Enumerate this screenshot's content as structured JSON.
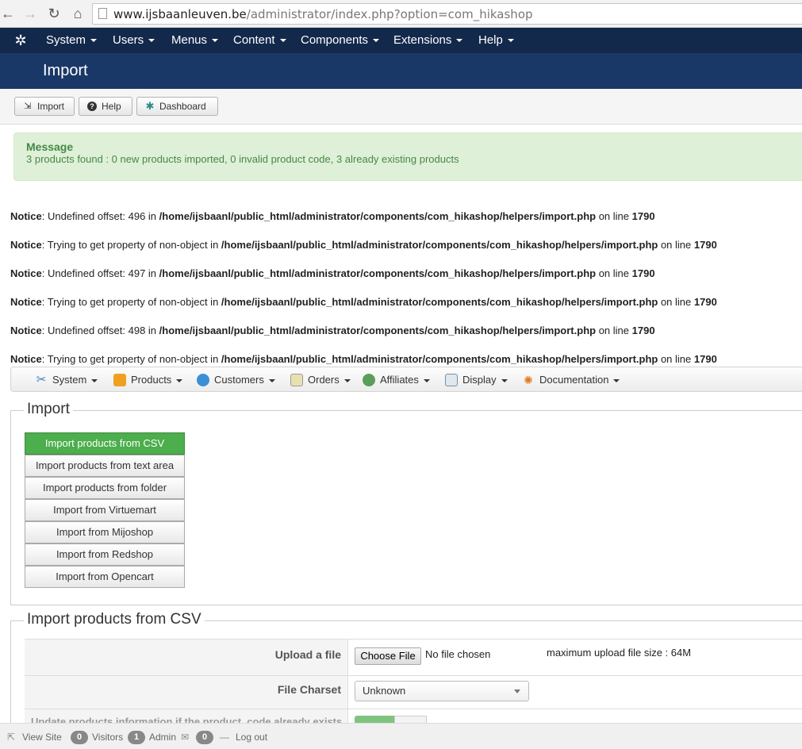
{
  "browser": {
    "url_host": "www.ijsbaanleuven.be",
    "url_path": "/administrator/index.php?option=com_hikashop"
  },
  "topnav": {
    "items": [
      "System",
      "Users",
      "Menus",
      "Content",
      "Components",
      "Extensions",
      "Help"
    ]
  },
  "header": {
    "title": "Import"
  },
  "toolbar": {
    "import_label": "Import",
    "help_label": "Help",
    "dashboard_label": "Dashboard"
  },
  "message": {
    "title": "Message",
    "text": "3 products found : 0 new products imported, 0 invalid product code, 3 already existing products"
  },
  "notices": [
    {
      "label": "Notice",
      "text": ": Undefined offset: 496 in ",
      "path": "/home/ijsbaanl/public_html/administrator/components/com_hikashop/helpers/import.php",
      "online": " on line ",
      "line": "1790"
    },
    {
      "label": "Notice",
      "text": ": Trying to get property of non-object in ",
      "path": "/home/ijsbaanl/public_html/administrator/components/com_hikashop/helpers/import.php",
      "online": " on line ",
      "line": "1790"
    },
    {
      "label": "Notice",
      "text": ": Undefined offset: 497 in ",
      "path": "/home/ijsbaanl/public_html/administrator/components/com_hikashop/helpers/import.php",
      "online": " on line ",
      "line": "1790"
    },
    {
      "label": "Notice",
      "text": ": Trying to get property of non-object in ",
      "path": "/home/ijsbaanl/public_html/administrator/components/com_hikashop/helpers/import.php",
      "online": " on line ",
      "line": "1790"
    },
    {
      "label": "Notice",
      "text": ": Undefined offset: 498 in ",
      "path": "/home/ijsbaanl/public_html/administrator/components/com_hikashop/helpers/import.php",
      "online": " on line ",
      "line": "1790"
    },
    {
      "label": "Notice",
      "text": ": Trying to get property of non-object in ",
      "path": "/home/ijsbaanl/public_html/administrator/components/com_hikashop/helpers/import.php",
      "online": " on line ",
      "line": "1790"
    }
  ],
  "submenu": {
    "items": [
      "System",
      "Products",
      "Customers",
      "Orders",
      "Affiliates",
      "Display",
      "Documentation"
    ]
  },
  "import_section": {
    "legend": "Import",
    "buttons": [
      "Import products from CSV",
      "Import products from text area",
      "Import products from folder",
      "Import from Virtuemart",
      "Import from Mijoshop",
      "Import from Redshop",
      "Import from Opencart"
    ]
  },
  "csv_section": {
    "legend": "Import products from CSV",
    "upload_label": "Upload a file",
    "choose_file": "Choose File",
    "no_file": "No file chosen",
    "max_size": "maximum upload file size : 64M",
    "charset_label": "File Charset",
    "charset_value": "Unknown",
    "update_label": "Update products information if the product_code already exists"
  },
  "statusbar": {
    "view_site": "View Site",
    "visitors_count": "0",
    "visitors": "Visitors",
    "admin_count": "1",
    "admin": "Admin",
    "messages_count": "0",
    "logout": "Log out"
  },
  "colors": {
    "topnav_bg": "#13294b",
    "header_bg": "#1a3867",
    "message_bg": "#dff0d8",
    "message_text": "#468847",
    "active_button": "#4cae4c"
  }
}
